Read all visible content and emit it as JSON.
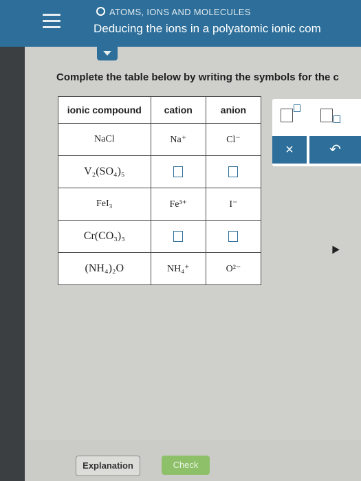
{
  "header": {
    "topic": "ATOMS, IONS AND MOLECULES",
    "title": "Deducing the ions in a polyatomic ionic com"
  },
  "instructions": "Complete the table below by writing the symbols for the c",
  "table": {
    "headers": [
      "ionic compound",
      "cation",
      "anion"
    ],
    "rows": [
      {
        "compound": "NaCl",
        "cation": "Na⁺",
        "anion": "Cl⁻",
        "cation_box": false,
        "anion_box": false
      },
      {
        "compound": "V₂(SO₄)₅",
        "cation": "",
        "anion": "",
        "cation_box": true,
        "anion_box": true
      },
      {
        "compound": "FeI₃",
        "cation": "Fe³⁺",
        "anion": "I⁻",
        "cation_box": false,
        "anion_box": false
      },
      {
        "compound": "Cr(CO₃)₃",
        "cation": "",
        "anion": "",
        "cation_box": true,
        "anion_box": true
      },
      {
        "compound": "(NH₄)₂O",
        "cation": "NH₄⁺",
        "anion": "O²⁻",
        "cation_box": false,
        "anion_box": false
      }
    ]
  },
  "palette": {
    "clear_symbol": "×",
    "undo_symbol": "↶"
  },
  "footer": {
    "explanation_label": "Explanation",
    "check_label": "Check"
  },
  "colors": {
    "header": "#2d6f9a",
    "check": "#8ec06a"
  }
}
